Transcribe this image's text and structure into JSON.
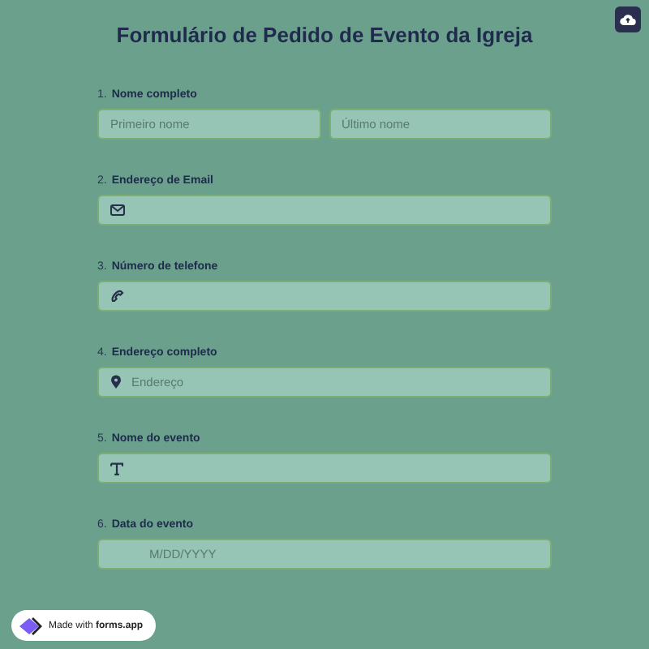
{
  "title": "Formulário de Pedido de Evento da Igreja",
  "questions": [
    {
      "number": "1.",
      "label": "Nome completo",
      "kind": "name",
      "fields": [
        {
          "placeholder": "Primeiro nome"
        },
        {
          "placeholder": "Último nome"
        }
      ]
    },
    {
      "number": "2.",
      "label": "Endereço de Email",
      "kind": "email"
    },
    {
      "number": "3.",
      "label": "Número de telefone",
      "kind": "phone"
    },
    {
      "number": "4.",
      "label": "Endereço completo",
      "kind": "address",
      "fields": [
        {
          "placeholder": "Endereço"
        }
      ]
    },
    {
      "number": "5.",
      "label": "Nome do evento",
      "kind": "text"
    },
    {
      "number": "6.",
      "label": "Data do evento",
      "kind": "date",
      "fields": [
        {
          "placeholder": "M/DD/YYYY"
        }
      ]
    }
  ],
  "badge": "Made with **forms.app**"
}
